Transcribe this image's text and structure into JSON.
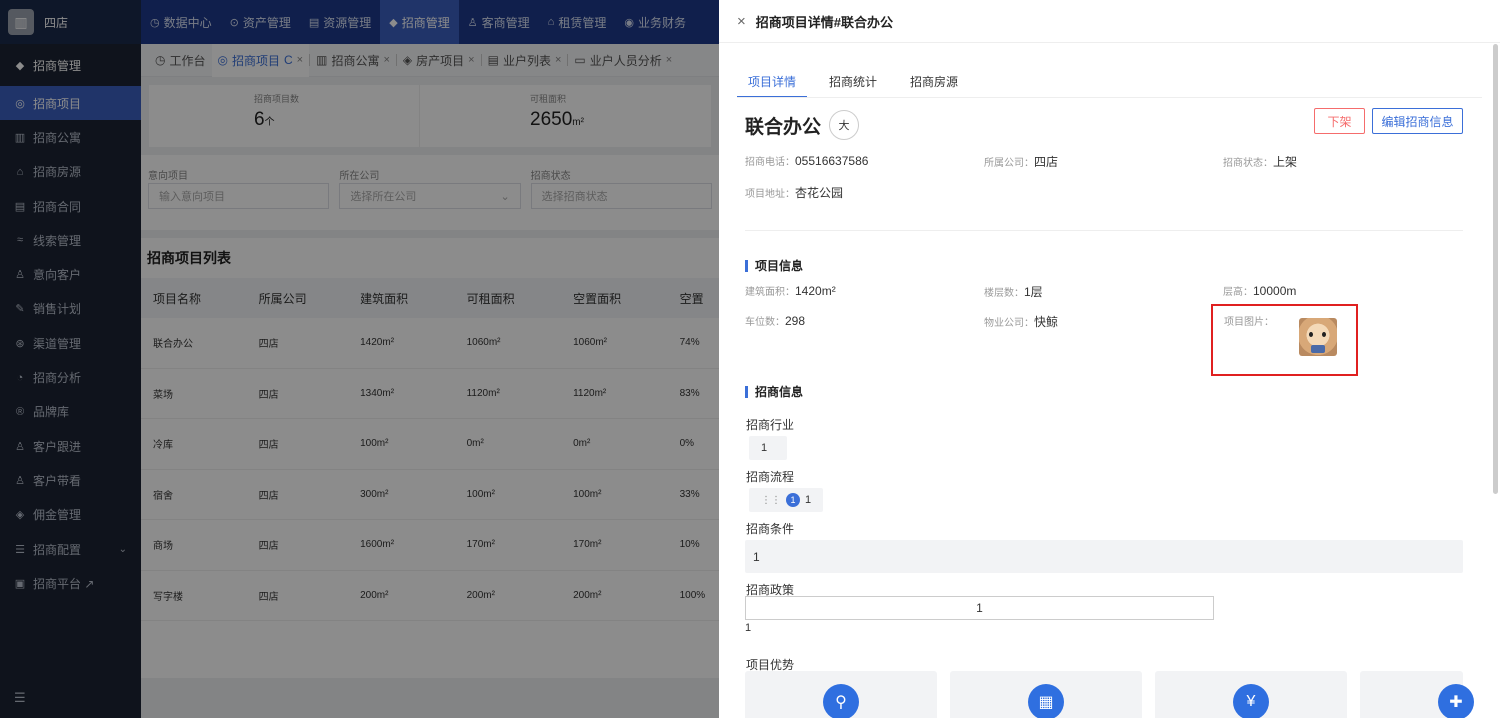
{
  "brand": {
    "name": "四店"
  },
  "topnav": [
    {
      "icon": "◷",
      "label": "数据中心"
    },
    {
      "icon": "⊙",
      "label": "资产管理"
    },
    {
      "icon": "▤",
      "label": "资源管理"
    },
    {
      "icon": "◆",
      "label": "招商管理"
    },
    {
      "icon": "♙",
      "label": "客商管理"
    },
    {
      "icon": "⌂",
      "label": "租赁管理"
    },
    {
      "icon": "◉",
      "label": "业务财务"
    }
  ],
  "sidebar": {
    "group": "招商管理",
    "items": [
      {
        "icon": "◎",
        "label": "招商项目"
      },
      {
        "icon": "▥",
        "label": "招商公寓"
      },
      {
        "icon": "⌂",
        "label": "招商房源"
      },
      {
        "icon": "▤",
        "label": "招商合同"
      },
      {
        "icon": "≈",
        "label": "线索管理"
      },
      {
        "icon": "♙",
        "label": "意向客户"
      },
      {
        "icon": "✎",
        "label": "销售计划"
      },
      {
        "icon": "⊛",
        "label": "渠道管理"
      },
      {
        "icon": "◔",
        "label": "招商分析"
      },
      {
        "icon": "®",
        "label": "品牌库"
      },
      {
        "icon": "♙",
        "label": "客户跟进"
      },
      {
        "icon": "♙",
        "label": "客户带看"
      },
      {
        "icon": "◈",
        "label": "佣金管理"
      },
      {
        "icon": "☰",
        "label": "招商配置"
      },
      {
        "icon": "▣",
        "label": "招商平台 ↗"
      }
    ]
  },
  "tabs": [
    {
      "icon": "◷",
      "label": "工作台"
    },
    {
      "icon": "◎",
      "label": "招商项目",
      "extra": "C",
      "close": "×"
    },
    {
      "icon": "▥",
      "label": "招商公寓",
      "close": "×"
    },
    {
      "icon": "◈",
      "label": "房产项目",
      "close": "×"
    },
    {
      "icon": "▤",
      "label": "业户列表",
      "close": "×"
    },
    {
      "icon": "▭",
      "label": "业户人员分析",
      "close": "×"
    }
  ],
  "stats": [
    {
      "label": "招商项目数",
      "value": "6",
      "unit": "个"
    },
    {
      "label": "可租面积",
      "value": "2650",
      "unit": "m²"
    }
  ],
  "filters": [
    {
      "label": "意向项目",
      "placeholder": "输入意向项目"
    },
    {
      "label": "所在公司",
      "placeholder": "选择所在公司",
      "arrow": "⌄"
    },
    {
      "label": "招商状态",
      "placeholder": "选择招商状态"
    }
  ],
  "list": {
    "title": "招商项目列表",
    "columns": [
      "项目名称",
      "所属公司",
      "建筑面积",
      "可租面积",
      "空置面积",
      "空置"
    ],
    "rows": [
      [
        "联合办公",
        "四店",
        "1420m²",
        "1060m²",
        "1060m²",
        "74%"
      ],
      [
        "菜场",
        "四店",
        "1340m²",
        "1120m²",
        "1120m²",
        "83%"
      ],
      [
        "冷库",
        "四店",
        "100m²",
        "0m²",
        "0m²",
        "0%"
      ],
      [
        "宿舍",
        "四店",
        "300m²",
        "100m²",
        "100m²",
        "33%"
      ],
      [
        "商场",
        "四店",
        "1600m²",
        "170m²",
        "170m²",
        "10%"
      ],
      [
        "写字楼",
        "四店",
        "200m²",
        "200m²",
        "200m²",
        "100%"
      ]
    ]
  },
  "drawer": {
    "close": "×",
    "title": "招商项目详情#联合办公",
    "tabs": [
      "项目详情",
      "招商统计",
      "招商房源"
    ],
    "project_name": "联合办公",
    "size_badge": "大",
    "btn_off": "下架",
    "btn_edit": "编辑招商信息",
    "phone": {
      "k": "招商电话：",
      "v": "05516637586"
    },
    "company": {
      "k": "所属公司：",
      "v": "四店"
    },
    "status": {
      "k": "招商状态：",
      "v": "上架"
    },
    "address": {
      "k": "项目地址：",
      "v": "杏花公园"
    },
    "section_project": "项目信息",
    "build_area": {
      "k": "建筑面积：",
      "v": "1420m²"
    },
    "floors": {
      "k": "楼层数：",
      "v": "1层"
    },
    "height": {
      "k": "层高：",
      "v": "10000m"
    },
    "parking": {
      "k": "车位数：",
      "v": "298"
    },
    "property": {
      "k": "物业公司：",
      "v": "快鲸"
    },
    "picture": {
      "k": "项目图片："
    },
    "section_biz": "招商信息",
    "industry_label": "招商行业",
    "industry_value": "1",
    "process_label": "招商流程",
    "process_step": "1",
    "process_value": "1",
    "condition_label": "招商条件",
    "condition_value": "1",
    "policy_label": "招商政策",
    "policy_value": "1",
    "policy_below": "1",
    "advantage_label": "项目优势",
    "advantage_icons": [
      "⚲",
      "▦",
      "¥",
      "✚"
    ]
  },
  "colors": {
    "accent": "#3b6fd8",
    "danger": "#f56c6c",
    "sidebar": "#1d2433",
    "topbar": "#1e3a8a"
  }
}
